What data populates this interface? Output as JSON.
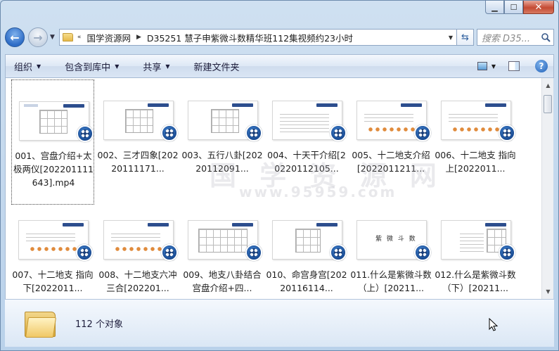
{
  "window": {
    "minimize": "▁",
    "maximize": "☐",
    "close": "✕"
  },
  "nav": {
    "back_glyph": "←",
    "forward_glyph": "→",
    "crumbs": [
      "国学资源网",
      "D35251 慧子申紫微斗数精华班112集视频约23小时"
    ],
    "search_placeholder": "搜索 D35..."
  },
  "commands": [
    {
      "label": "组织",
      "has_menu": true
    },
    {
      "label": "包含到库中",
      "has_menu": true
    },
    {
      "label": "共享",
      "has_menu": true
    },
    {
      "label": "新建文件夹",
      "has_menu": false
    }
  ],
  "files": [
    {
      "label": "001、宫盘介绍+太极两仪[202201111643].mp4",
      "selected": true
    },
    {
      "label": "002、三才四象[20220111171...",
      "selected": false
    },
    {
      "label": "003、五行八卦[20220112091...",
      "selected": false
    },
    {
      "label": "004、十天干介绍[20220112105...",
      "selected": false
    },
    {
      "label": "005、十二地支介绍[2022011211...",
      "selected": false
    },
    {
      "label": "006、十二地支 指向 上[2022011...",
      "selected": false
    },
    {
      "label": "007、十二地支 指向 下[2022011...",
      "selected": false
    },
    {
      "label": "008、十二地支六冲三合[202201...",
      "selected": false
    },
    {
      "label": "009、地支八卦结合宫盘介绍+四...",
      "selected": false
    },
    {
      "label": "010、命宫身宫[20220116114...",
      "selected": false
    },
    {
      "label": "011.什么是紫微斗数（上）[20211...",
      "selected": false
    },
    {
      "label": "012.什么是紫微斗数（下）[20211...",
      "selected": false
    }
  ],
  "thumb_text": {
    "ziwei": "紫 微 斗 数"
  },
  "watermark": {
    "big": "国 学 资 源 网",
    "url": "www.95959.com"
  },
  "status": {
    "count_text": "112 个对象"
  },
  "colors": {
    "accent": "#2d6cc6",
    "chrome": "#cfe0f1"
  }
}
